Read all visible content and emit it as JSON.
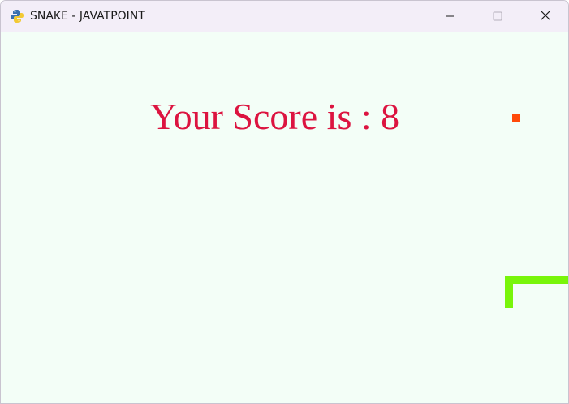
{
  "window": {
    "title": "SNAKE - JAVATPOINT",
    "app_icon": "python-pygame-icon"
  },
  "controls": {
    "minimize_icon": "minimize-icon",
    "maximize_icon": "maximize-icon",
    "close_icon": "close-icon"
  },
  "game": {
    "score_text": "Your Score is : 8",
    "score_value": 8,
    "colors": {
      "background": "#f3fef7",
      "score_text": "#dc1440",
      "food": "#ff4a0a",
      "snake": "#78f50a"
    }
  }
}
